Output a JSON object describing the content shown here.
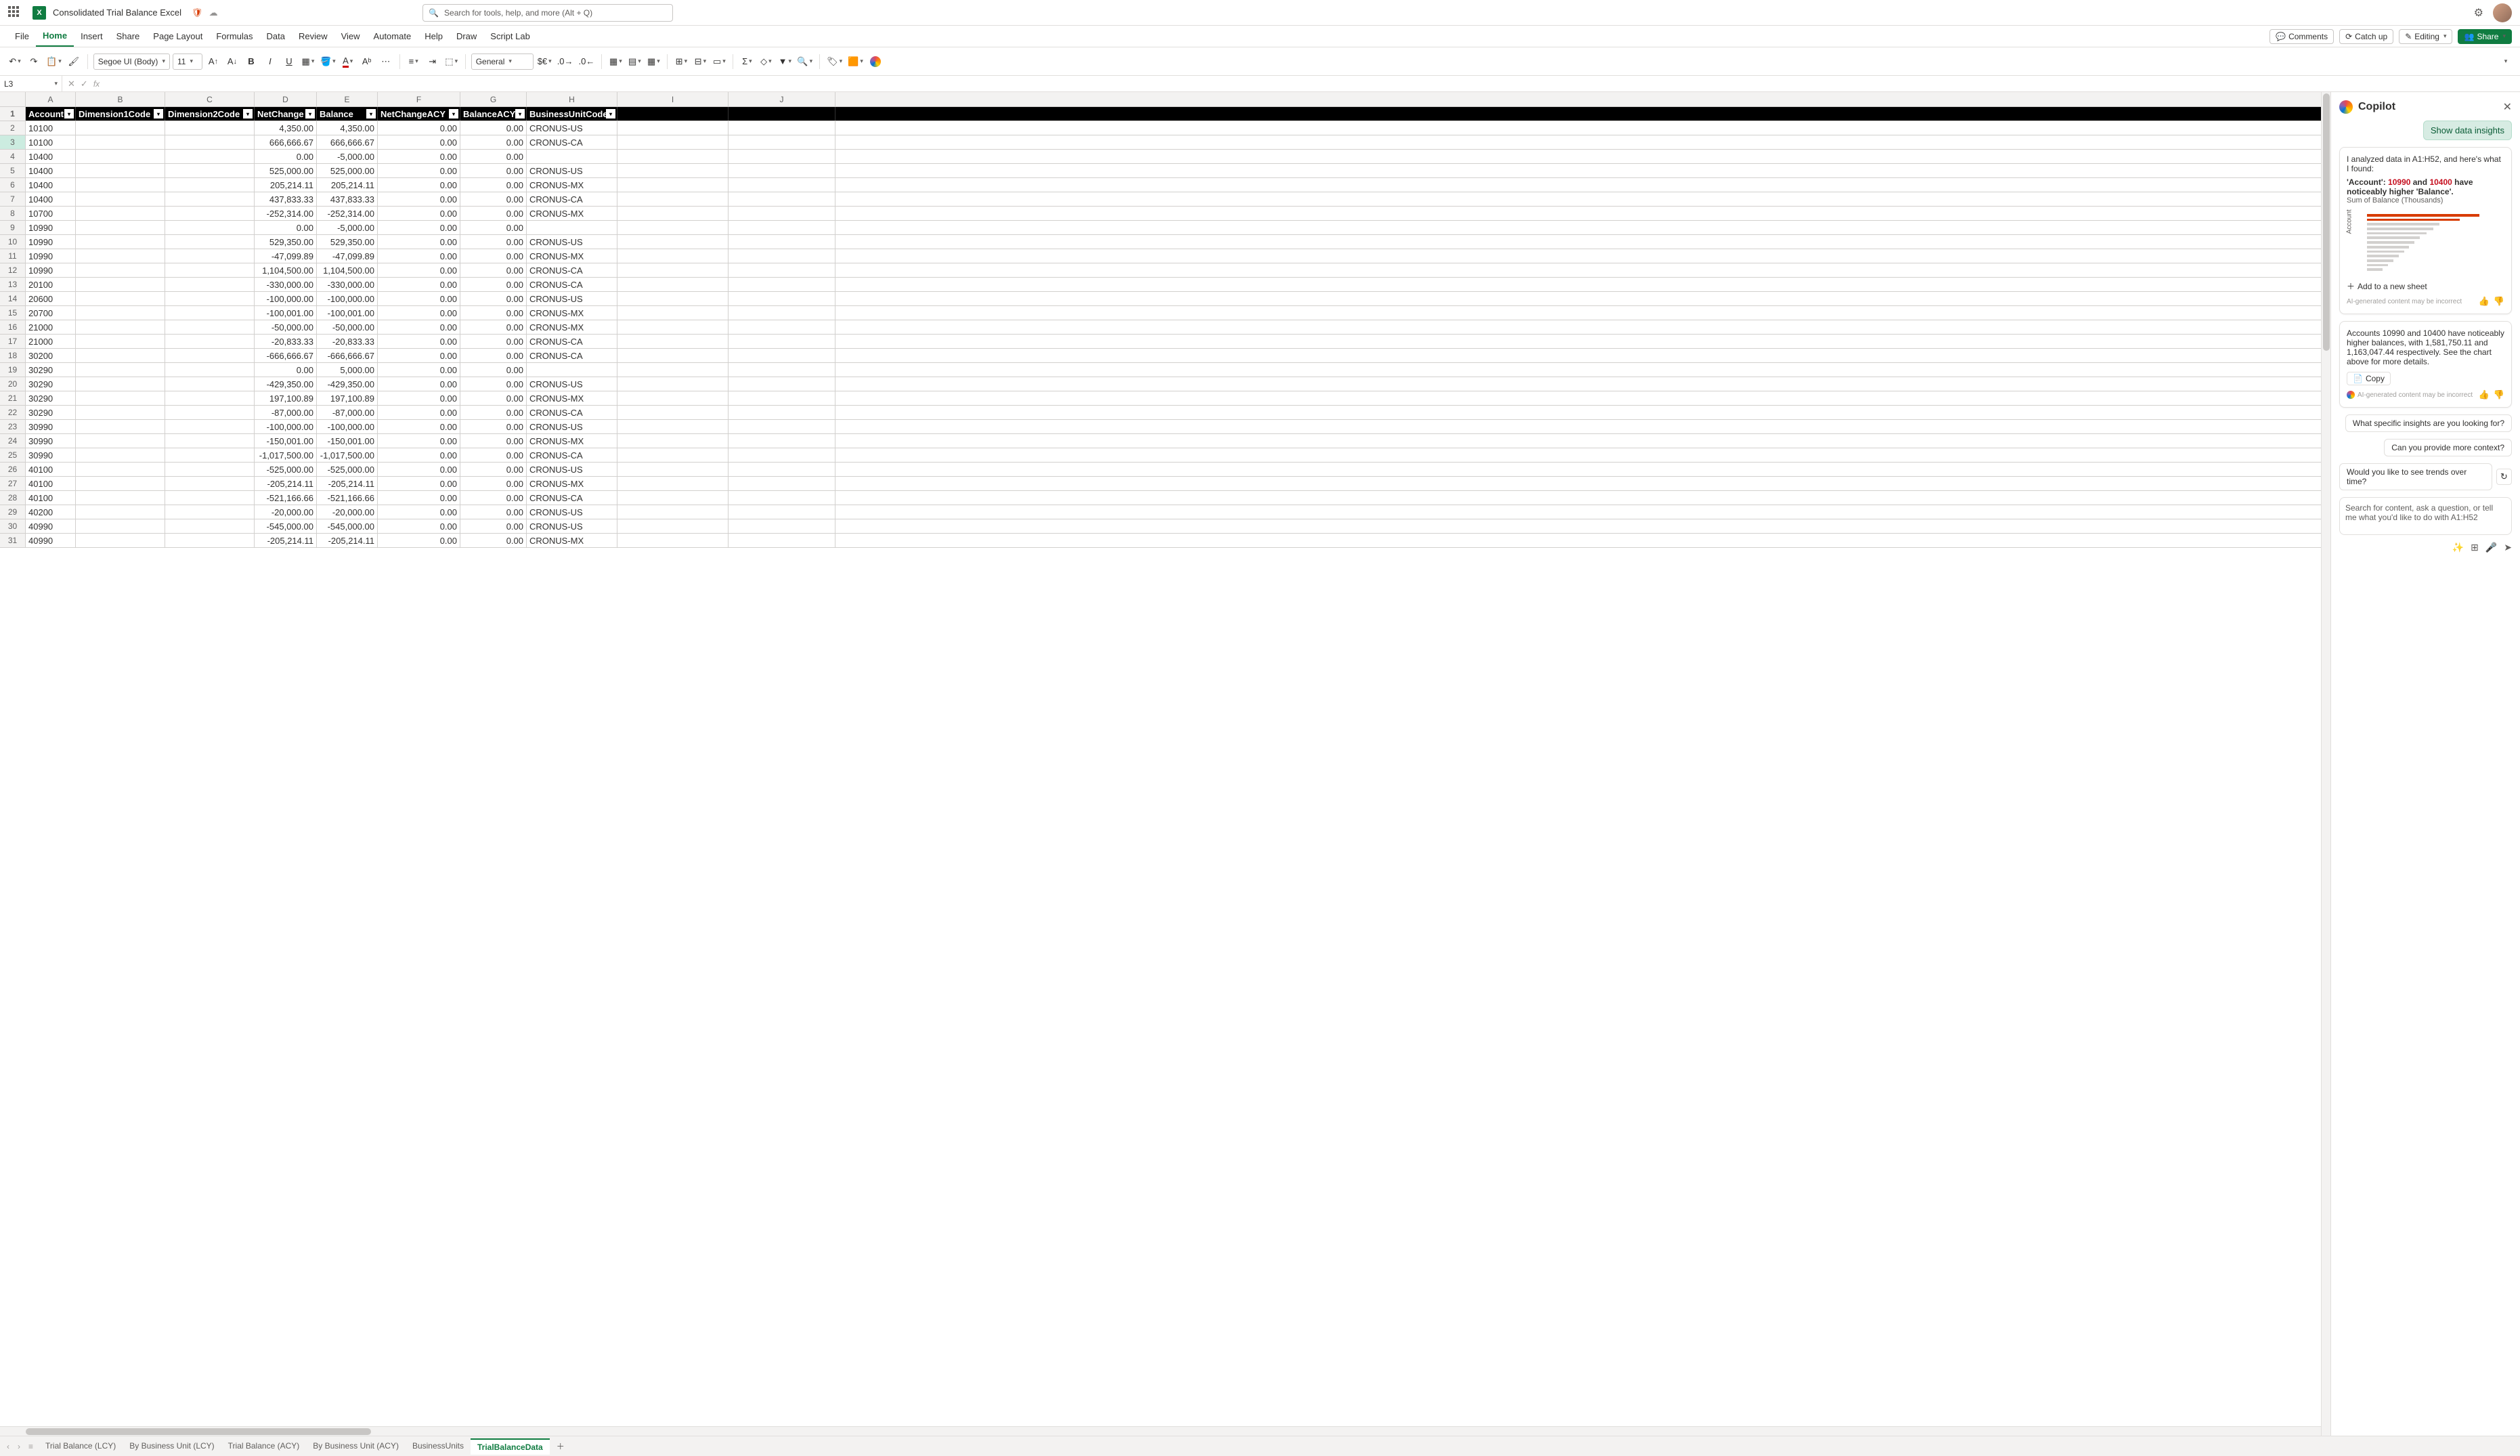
{
  "title": "Consolidated Trial Balance Excel",
  "search_placeholder": "Search for tools, help, and more (Alt + Q)",
  "ribbon": {
    "tabs": [
      "File",
      "Home",
      "Insert",
      "Share",
      "Page Layout",
      "Formulas",
      "Data",
      "Review",
      "View",
      "Automate",
      "Help",
      "Draw",
      "Script Lab"
    ],
    "active": "Home",
    "comments": "Comments",
    "catchup": "Catch up",
    "editing": "Editing",
    "share": "Share"
  },
  "toolbar": {
    "font": "Segoe UI (Body)",
    "font_size": "11",
    "number_format": "General"
  },
  "name_box": "L3",
  "columns": [
    "A",
    "B",
    "C",
    "D",
    "E",
    "F",
    "G",
    "H",
    "I",
    "J"
  ],
  "headers": [
    "Account",
    "Dimension1Code",
    "Dimension2Code",
    "NetChange",
    "Balance",
    "NetChangeACY",
    "BalanceACY",
    "BusinessUnitCode"
  ],
  "rows": [
    {
      "n": 2,
      "a": "10100",
      "d": "4,350.00",
      "e": "4,350.00",
      "f": "0.00",
      "g": "0.00",
      "h": "CRONUS-US"
    },
    {
      "n": 3,
      "a": "10100",
      "d": "666,666.67",
      "e": "666,666.67",
      "f": "0.00",
      "g": "0.00",
      "h": "CRONUS-CA"
    },
    {
      "n": 4,
      "a": "10400",
      "d": "0.00",
      "e": "-5,000.00",
      "f": "0.00",
      "g": "0.00",
      "h": ""
    },
    {
      "n": 5,
      "a": "10400",
      "d": "525,000.00",
      "e": "525,000.00",
      "f": "0.00",
      "g": "0.00",
      "h": "CRONUS-US"
    },
    {
      "n": 6,
      "a": "10400",
      "d": "205,214.11",
      "e": "205,214.11",
      "f": "0.00",
      "g": "0.00",
      "h": "CRONUS-MX"
    },
    {
      "n": 7,
      "a": "10400",
      "d": "437,833.33",
      "e": "437,833.33",
      "f": "0.00",
      "g": "0.00",
      "h": "CRONUS-CA"
    },
    {
      "n": 8,
      "a": "10700",
      "d": "-252,314.00",
      "e": "-252,314.00",
      "f": "0.00",
      "g": "0.00",
      "h": "CRONUS-MX"
    },
    {
      "n": 9,
      "a": "10990",
      "d": "0.00",
      "e": "-5,000.00",
      "f": "0.00",
      "g": "0.00",
      "h": ""
    },
    {
      "n": 10,
      "a": "10990",
      "d": "529,350.00",
      "e": "529,350.00",
      "f": "0.00",
      "g": "0.00",
      "h": "CRONUS-US"
    },
    {
      "n": 11,
      "a": "10990",
      "d": "-47,099.89",
      "e": "-47,099.89",
      "f": "0.00",
      "g": "0.00",
      "h": "CRONUS-MX"
    },
    {
      "n": 12,
      "a": "10990",
      "d": "1,104,500.00",
      "e": "1,104,500.00",
      "f": "0.00",
      "g": "0.00",
      "h": "CRONUS-CA"
    },
    {
      "n": 13,
      "a": "20100",
      "d": "-330,000.00",
      "e": "-330,000.00",
      "f": "0.00",
      "g": "0.00",
      "h": "CRONUS-CA"
    },
    {
      "n": 14,
      "a": "20600",
      "d": "-100,000.00",
      "e": "-100,000.00",
      "f": "0.00",
      "g": "0.00",
      "h": "CRONUS-US"
    },
    {
      "n": 15,
      "a": "20700",
      "d": "-100,001.00",
      "e": "-100,001.00",
      "f": "0.00",
      "g": "0.00",
      "h": "CRONUS-MX"
    },
    {
      "n": 16,
      "a": "21000",
      "d": "-50,000.00",
      "e": "-50,000.00",
      "f": "0.00",
      "g": "0.00",
      "h": "CRONUS-MX"
    },
    {
      "n": 17,
      "a": "21000",
      "d": "-20,833.33",
      "e": "-20,833.33",
      "f": "0.00",
      "g": "0.00",
      "h": "CRONUS-CA"
    },
    {
      "n": 18,
      "a": "30200",
      "d": "-666,666.67",
      "e": "-666,666.67",
      "f": "0.00",
      "g": "0.00",
      "h": "CRONUS-CA"
    },
    {
      "n": 19,
      "a": "30290",
      "d": "0.00",
      "e": "5,000.00",
      "f": "0.00",
      "g": "0.00",
      "h": ""
    },
    {
      "n": 20,
      "a": "30290",
      "d": "-429,350.00",
      "e": "-429,350.00",
      "f": "0.00",
      "g": "0.00",
      "h": "CRONUS-US"
    },
    {
      "n": 21,
      "a": "30290",
      "d": "197,100.89",
      "e": "197,100.89",
      "f": "0.00",
      "g": "0.00",
      "h": "CRONUS-MX"
    },
    {
      "n": 22,
      "a": "30290",
      "d": "-87,000.00",
      "e": "-87,000.00",
      "f": "0.00",
      "g": "0.00",
      "h": "CRONUS-CA"
    },
    {
      "n": 23,
      "a": "30990",
      "d": "-100,000.00",
      "e": "-100,000.00",
      "f": "0.00",
      "g": "0.00",
      "h": "CRONUS-US"
    },
    {
      "n": 24,
      "a": "30990",
      "d": "-150,001.00",
      "e": "-150,001.00",
      "f": "0.00",
      "g": "0.00",
      "h": "CRONUS-MX"
    },
    {
      "n": 25,
      "a": "30990",
      "d": "-1,017,500.00",
      "e": "-1,017,500.00",
      "f": "0.00",
      "g": "0.00",
      "h": "CRONUS-CA"
    },
    {
      "n": 26,
      "a": "40100",
      "d": "-525,000.00",
      "e": "-525,000.00",
      "f": "0.00",
      "g": "0.00",
      "h": "CRONUS-US"
    },
    {
      "n": 27,
      "a": "40100",
      "d": "-205,214.11",
      "e": "-205,214.11",
      "f": "0.00",
      "g": "0.00",
      "h": "CRONUS-MX"
    },
    {
      "n": 28,
      "a": "40100",
      "d": "-521,166.66",
      "e": "-521,166.66",
      "f": "0.00",
      "g": "0.00",
      "h": "CRONUS-CA"
    },
    {
      "n": 29,
      "a": "40200",
      "d": "-20,000.00",
      "e": "-20,000.00",
      "f": "0.00",
      "g": "0.00",
      "h": "CRONUS-US"
    },
    {
      "n": 30,
      "a": "40990",
      "d": "-545,000.00",
      "e": "-545,000.00",
      "f": "0.00",
      "g": "0.00",
      "h": "CRONUS-US"
    },
    {
      "n": 31,
      "a": "40990",
      "d": "-205,214.11",
      "e": "-205,214.11",
      "f": "0.00",
      "g": "0.00",
      "h": "CRONUS-MX"
    }
  ],
  "copilot": {
    "title": "Copilot",
    "chip": "Show data insights",
    "analysis_intro": "I analyzed data in A1:H52, and here's what I found:",
    "acct_label": "'Account': ",
    "acct1": "10990",
    "and": " and ",
    "acct2": "10400",
    "acct_tail": " have noticeably higher 'Balance'.",
    "chart_caption": "Sum of Balance (Thousands)",
    "chart_axis": "Account",
    "add_sheet": "Add to a new sheet",
    "ai_note": "AI-generated content may be incorrect",
    "summary": "Accounts 10990 and 10400 have noticeably higher balances, with 1,581,750.11 and 1,163,047.44 respectively. See the chart above for more details.",
    "copy": "Copy",
    "sug1": "What specific insights are you looking for?",
    "sug2": "Can you provide more context?",
    "sug3": "Would you like to see trends over time?",
    "input_placeholder": "Search for content, ask a question, or tell me what you'd like to do with A1:H52"
  },
  "sheets": {
    "tabs": [
      "Trial Balance (LCY)",
      "By Business Unit (LCY)",
      "Trial Balance (ACY)",
      "By Business Unit (ACY)",
      "BusinessUnits",
      "TrialBalanceData"
    ],
    "active": "TrialBalanceData"
  },
  "chart_data": {
    "type": "bar",
    "orientation": "horizontal",
    "title": "Sum of Balance (Thousands)",
    "ylabel": "Account",
    "note": "Bars shown without individual labels; two highlighted outliers (10990, 10400) rendered in orange near top",
    "approx_bar_count": 15
  }
}
